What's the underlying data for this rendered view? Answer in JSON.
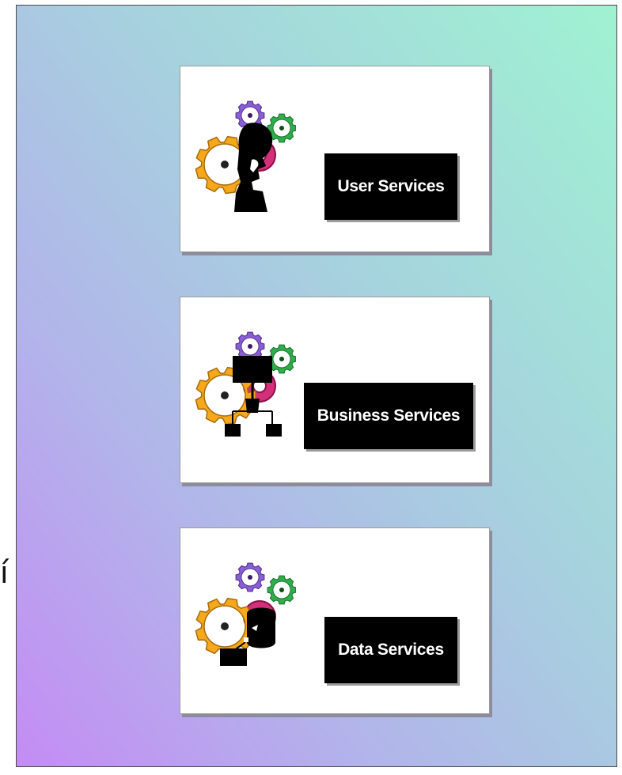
{
  "diagram": {
    "layers": [
      {
        "label": "User Services",
        "icon": "gears-person-icon"
      },
      {
        "label": "Business Services",
        "icon": "gears-org-chart-icon"
      },
      {
        "label": "Data Services",
        "icon": "gears-database-icon"
      }
    ],
    "edge_glyph": "í",
    "colors": {
      "gradient_start": "#c48cf4",
      "gradient_end": "#9ff2d2",
      "gear_orange": "#f5a81c",
      "gear_purple": "#8a5ed6",
      "gear_green": "#2fae4c",
      "gear_magenta": "#d4307a",
      "label_bg": "#000000",
      "label_text": "#ffffff"
    }
  }
}
